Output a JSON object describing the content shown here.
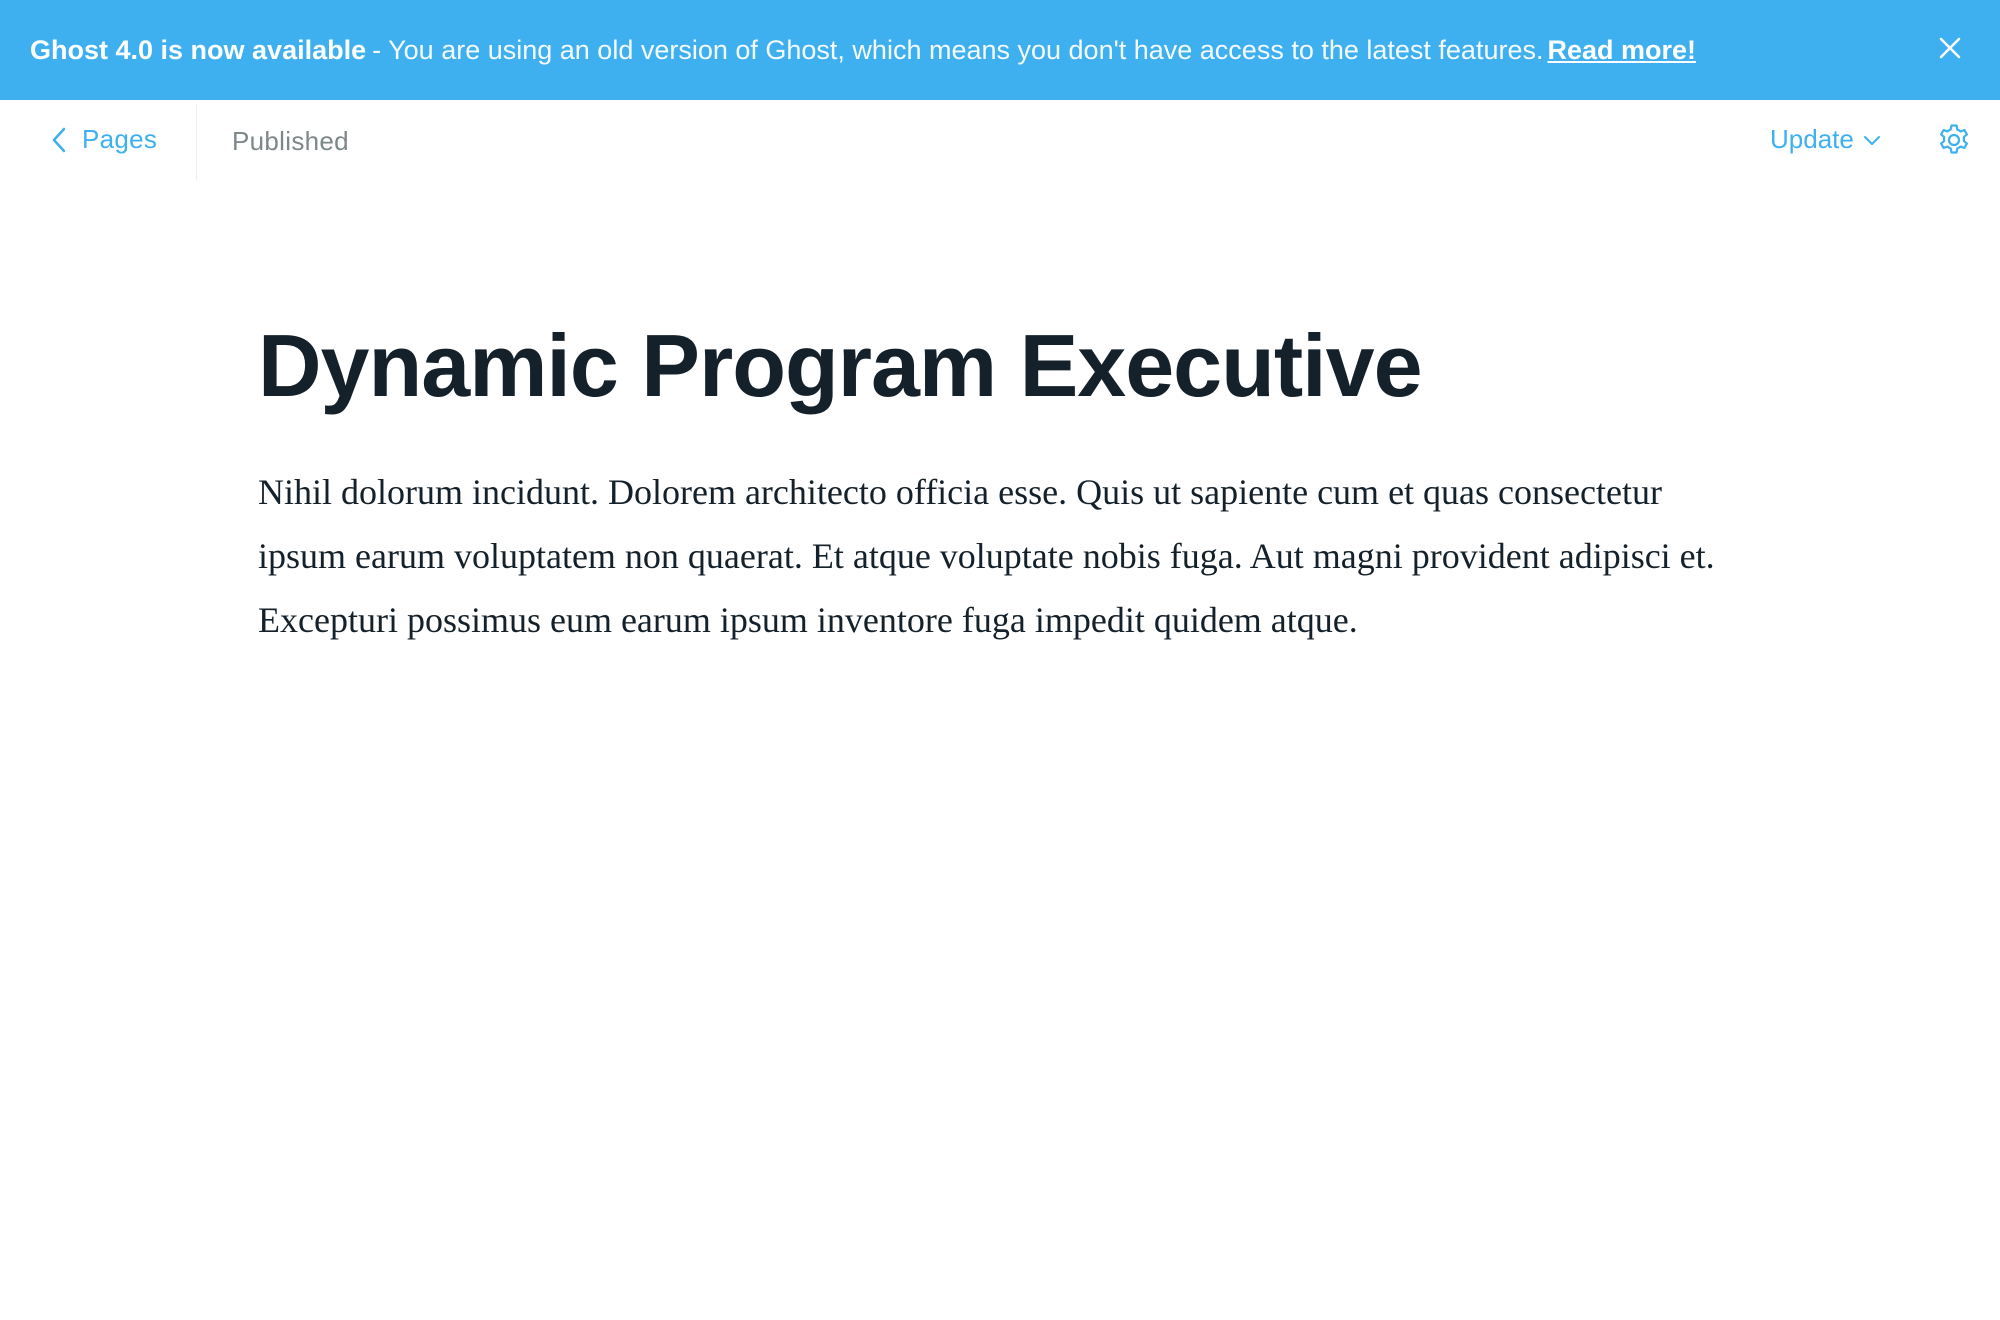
{
  "banner": {
    "title": "Ghost 4.0 is now available",
    "message": "- You are using an old version of Ghost, which means you don't have access to the latest features.",
    "link_label": "Read more!",
    "close_icon": "close-icon",
    "color": "#3eb0ef"
  },
  "header": {
    "back_label": "Pages",
    "back_icon": "chevron-left-icon",
    "status": "Published",
    "update_label": "Update",
    "update_icon": "chevron-down-icon",
    "settings_icon": "gear-icon",
    "accent": "#3eb0ef"
  },
  "post": {
    "title": "Dynamic Program Executive",
    "body": "Nihil dolorum incidunt. Dolorem architecto officia esse. Quis ut sapiente cum et quas consectetur ipsum earum voluptatem non quaerat. Et atque voluptate nobis fuga. Aut magni provident adipisci et. Excepturi possimus eum earum ipsum inventore fuga impedit quidem atque."
  }
}
